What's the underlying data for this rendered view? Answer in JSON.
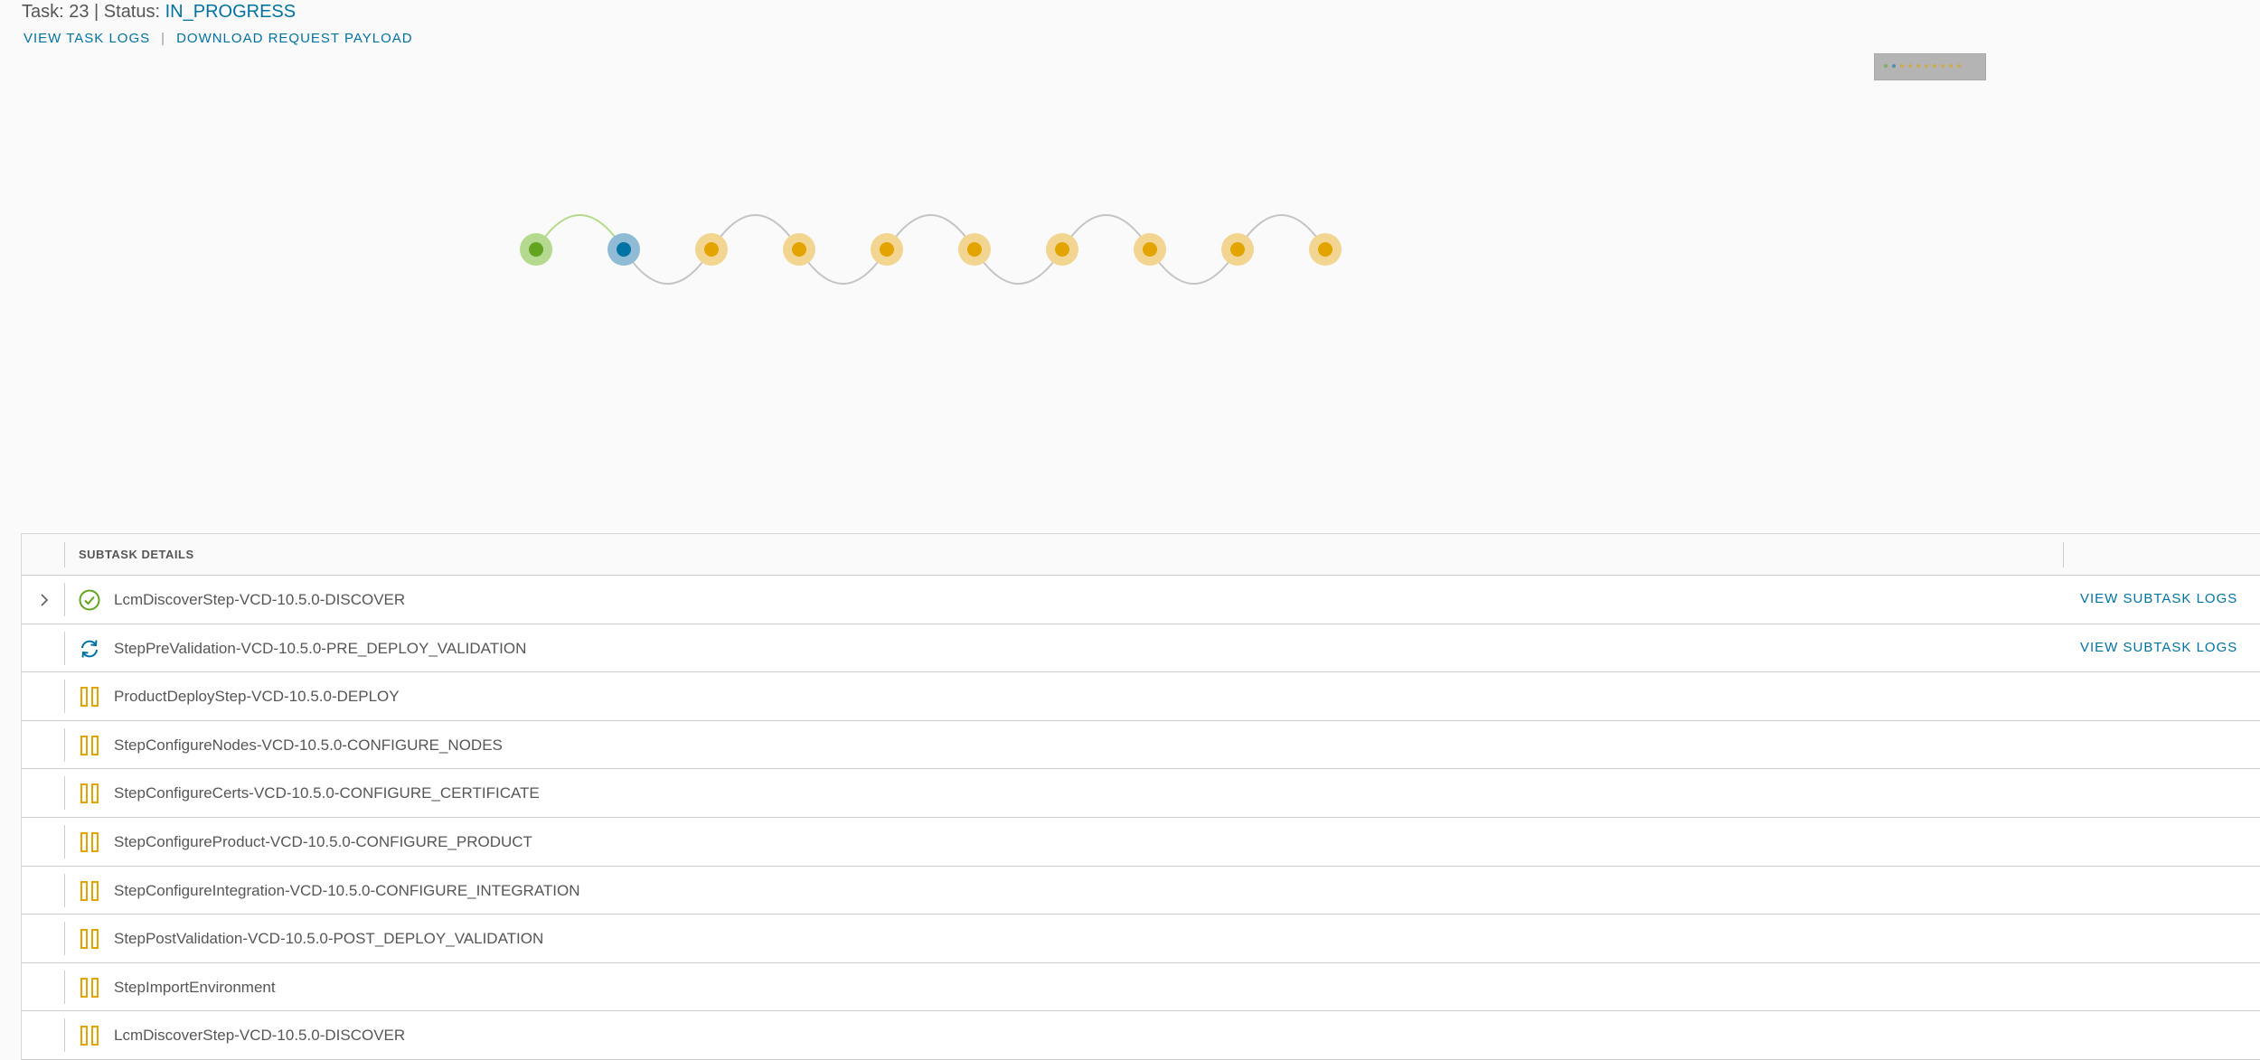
{
  "header": {
    "title_prefix": "Task: 23 | Status: ",
    "status": "IN_PROGRESS",
    "view_task_logs": "VIEW TASK LOGS",
    "separator": "|",
    "download_payload": "DOWNLOAD REQUEST PAYLOAD"
  },
  "graph": {
    "nodes": [
      {
        "state": "completed"
      },
      {
        "state": "in-progress"
      },
      {
        "state": "pending"
      },
      {
        "state": "pending"
      },
      {
        "state": "pending"
      },
      {
        "state": "pending"
      },
      {
        "state": "pending"
      },
      {
        "state": "pending"
      },
      {
        "state": "pending"
      },
      {
        "state": "pending"
      }
    ]
  },
  "colors": {
    "completed": "#62a420",
    "completed_halo": "#b5d98f",
    "in_progress": "#0072a3",
    "in_progress_halo": "#8fbcd4",
    "pending": "#e3a400",
    "pending_halo": "#f2d591",
    "link_done": "#b5db8a",
    "link": "#c4c4c4"
  },
  "table": {
    "header": "SUBTASK DETAILS",
    "rows": [
      {
        "name": "LcmDiscoverStep-VCD-10.5.0-DISCOVER",
        "status": "completed",
        "icon": "check-circle-icon",
        "expandable": true,
        "link": "VIEW SUBTASK LOGS"
      },
      {
        "name": "StepPreValidation-VCD-10.5.0-PRE_DEPLOY_VALIDATION",
        "status": "in-progress",
        "icon": "sync-icon",
        "expandable": false,
        "link": "VIEW SUBTASK LOGS"
      },
      {
        "name": "ProductDeployStep-VCD-10.5.0-DEPLOY",
        "status": "pending",
        "icon": "pause-icon",
        "expandable": false,
        "link": ""
      },
      {
        "name": "StepConfigureNodes-VCD-10.5.0-CONFIGURE_NODES",
        "status": "pending",
        "icon": "pause-icon",
        "expandable": false,
        "link": ""
      },
      {
        "name": "StepConfigureCerts-VCD-10.5.0-CONFIGURE_CERTIFICATE",
        "status": "pending",
        "icon": "pause-icon",
        "expandable": false,
        "link": ""
      },
      {
        "name": "StepConfigureProduct-VCD-10.5.0-CONFIGURE_PRODUCT",
        "status": "pending",
        "icon": "pause-icon",
        "expandable": false,
        "link": ""
      },
      {
        "name": "StepConfigureIntegration-VCD-10.5.0-CONFIGURE_INTEGRATION",
        "status": "pending",
        "icon": "pause-icon",
        "expandable": false,
        "link": ""
      },
      {
        "name": "StepPostValidation-VCD-10.5.0-POST_DEPLOY_VALIDATION",
        "status": "pending",
        "icon": "pause-icon",
        "expandable": false,
        "link": ""
      },
      {
        "name": "StepImportEnvironment",
        "status": "pending",
        "icon": "pause-icon",
        "expandable": false,
        "link": ""
      },
      {
        "name": "LcmDiscoverStep-VCD-10.5.0-DISCOVER",
        "status": "pending",
        "icon": "pause-icon",
        "expandable": false,
        "link": ""
      }
    ]
  }
}
